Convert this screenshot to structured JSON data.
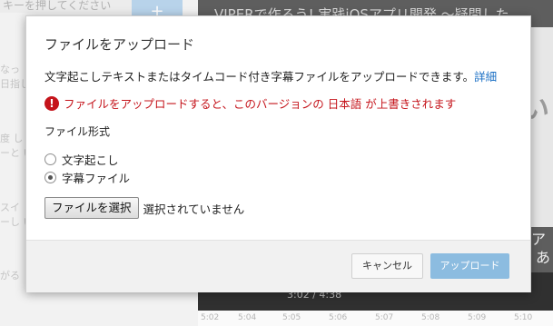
{
  "background": {
    "left_top_text": "キーを押してください",
    "left_button": "+",
    "left_snippets": [
      "なっ",
      "日指し",
      "度 し",
      "ーと い",
      "スイ",
      "ーし い",
      "がる"
    ],
    "video_title": "VIPERで作ろう! 実践iOSアプリ開発 〜疑問した",
    "video_big_text": "い",
    "subtitle_line1": "ア",
    "subtitle_line2": "あ",
    "time_display": "3:02 / 4:38",
    "timeline_ticks": [
      "5:02",
      "5:04",
      "5:05",
      "5:06",
      "5:07",
      "5:08",
      "5:09",
      "5:10"
    ]
  },
  "modal": {
    "title": "ファイルをアップロード",
    "description": "文字起こしテキストまたはタイムコード付き字幕ファイルをアップロードできます。",
    "details_link": "詳細",
    "warning_icon": "!",
    "warning_text": "ファイルをアップロードすると、このバージョンの 日本語 が上書きされます",
    "format_label": "ファイル形式",
    "options": [
      {
        "label": "文字起こし",
        "checked": false
      },
      {
        "label": "字幕ファイル",
        "checked": true
      }
    ],
    "choose_file_button": "ファイルを選択",
    "file_status": "選択されていません",
    "cancel_button": "キャンセル",
    "upload_button": "アップロード"
  },
  "colors": {
    "warning": "#c5141b",
    "link": "#1a6fc4",
    "primary_button": "#8cbce0"
  }
}
